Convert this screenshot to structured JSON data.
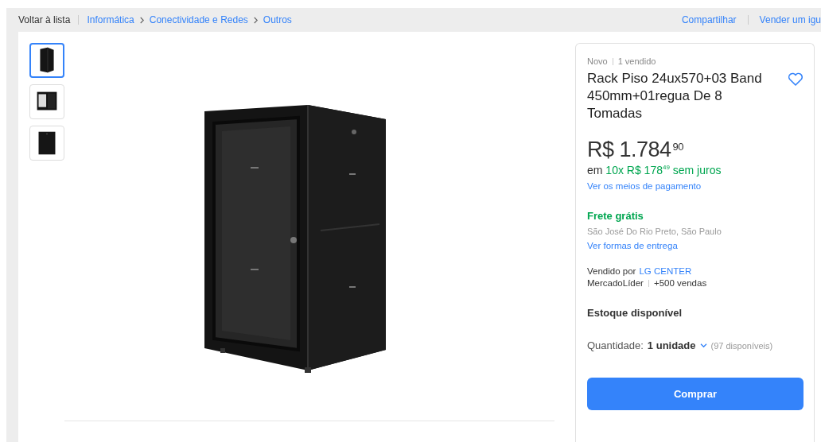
{
  "nav": {
    "back": "Voltar à lista",
    "breadcrumb": [
      "Informática",
      "Conectividade e Redes",
      "Outros"
    ],
    "actions": [
      "Compartilhar",
      "Vender um igu"
    ]
  },
  "gallery": {
    "thumbnails": [
      {
        "kind": "angle",
        "selected": true
      },
      {
        "kind": "open",
        "selected": false
      },
      {
        "kind": "front",
        "selected": false
      }
    ]
  },
  "product": {
    "condition": "Novo",
    "sold": "1 vendido",
    "title": "Rack Piso 24ux570+03 Band 450mm+01regua De 8 Tomadas",
    "price": "R$ 1.784",
    "price_cents": "90",
    "installments": {
      "prefix": "em",
      "amount": "10x R$ 178",
      "cents": "49",
      "suffix": "sem juros"
    },
    "payment_link": "Ver os meios de pagamento",
    "shipping": "Frete grátis",
    "location": "São José Do Rio Preto, São Paulo",
    "delivery_link": "Ver formas de entrega",
    "seller_prefix": "Vendido por",
    "seller": "LG CENTER",
    "seller_badge": "MercadoLíder",
    "seller_sales": "+500 vendas",
    "stock": "Estoque disponível",
    "quantity_label": "Quantidade:",
    "quantity": "1 unidade",
    "available": "(97 disponíveis)",
    "buy": "Comprar"
  }
}
